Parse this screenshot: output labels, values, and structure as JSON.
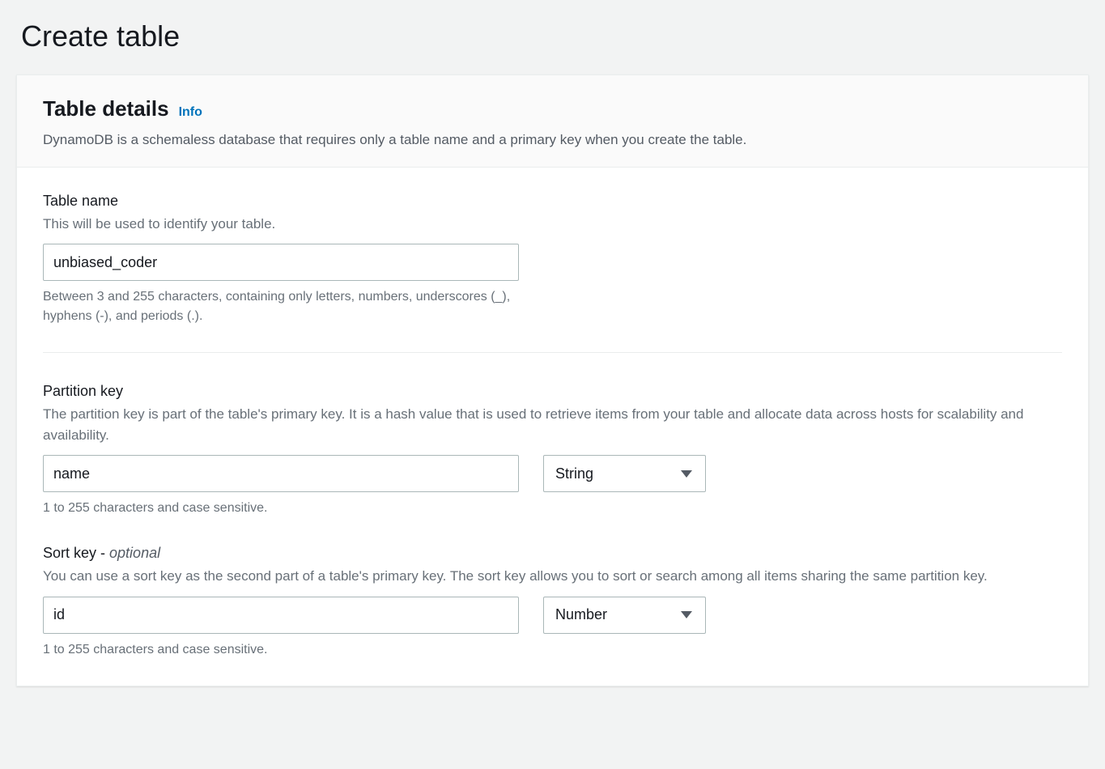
{
  "page": {
    "title": "Create table"
  },
  "panel": {
    "heading": "Table details",
    "info_link": "Info",
    "description": "DynamoDB is a schemaless database that requires only a table name and a primary key when you create the table."
  },
  "table_name": {
    "label": "Table name",
    "help": "This will be used to identify your table.",
    "value": "unbiased_coder",
    "constraint": "Between 3 and 255 characters, containing only letters, numbers, underscores (_), hyphens (-), and periods (.)."
  },
  "partition_key": {
    "label": "Partition key",
    "help": "The partition key is part of the table's primary key. It is a hash value that is used to retrieve items from your table and allocate data across hosts for scalability and availability.",
    "value": "name",
    "type_selected": "String",
    "constraint": "1 to 255 characters and case sensitive."
  },
  "sort_key": {
    "label_prefix": "Sort key - ",
    "optional_tag": "optional",
    "help": "You can use a sort key as the second part of a table's primary key. The sort key allows you to sort or search among all items sharing the same partition key.",
    "value": "id",
    "type_selected": "Number",
    "constraint": "1 to 255 characters and case sensitive."
  }
}
